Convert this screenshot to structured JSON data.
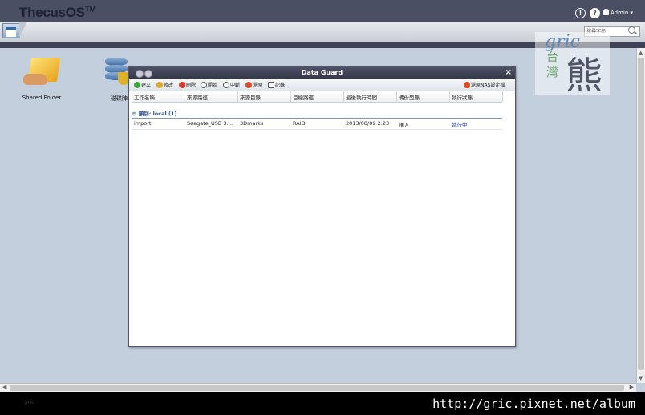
{
  "app": {
    "logo": "ThecusOS",
    "logo_tm": "TM"
  },
  "topbar": {
    "info_icon": "!",
    "help_icon": "?",
    "user_label": "Admin"
  },
  "search": {
    "placeholder": "搜尋字串"
  },
  "desktop": {
    "icons": [
      {
        "label": "Shared Folder",
        "icon": "shared-folder-icon"
      },
      {
        "label": "磁碟陣",
        "icon": "database-shield-icon"
      }
    ]
  },
  "watermark": {
    "gric": "gric",
    "taiwan": "台灣",
    "bear": "熊"
  },
  "window": {
    "title": "Data Guard",
    "close_label": "×",
    "toolbar": {
      "create": "建立",
      "edit": "修改",
      "delete": "刪除",
      "start": "開始",
      "stop": "中斷",
      "restore": "還原",
      "log": "記錄",
      "restore_nas": "還原NAS設定檔"
    },
    "columns": [
      "工作名稱",
      "來源路徑",
      "來源目錄",
      "目標路徑",
      "最後執行時間",
      "備份型態",
      "執行狀態"
    ],
    "group_label": "類別: local (1)",
    "rows": [
      [
        "import",
        "Seagate_USB 3....",
        "3Dmarks",
        "RAID",
        "2013/08/09 2:23",
        "匯入",
        "執行中"
      ]
    ]
  },
  "footer": {
    "ghost_text": "gric",
    "url": "http://gric.pixnet.net/album"
  },
  "colors": {
    "topbar": "#4b4f63",
    "desktop": "#c3cfdc",
    "running": "#1f3fc0"
  }
}
